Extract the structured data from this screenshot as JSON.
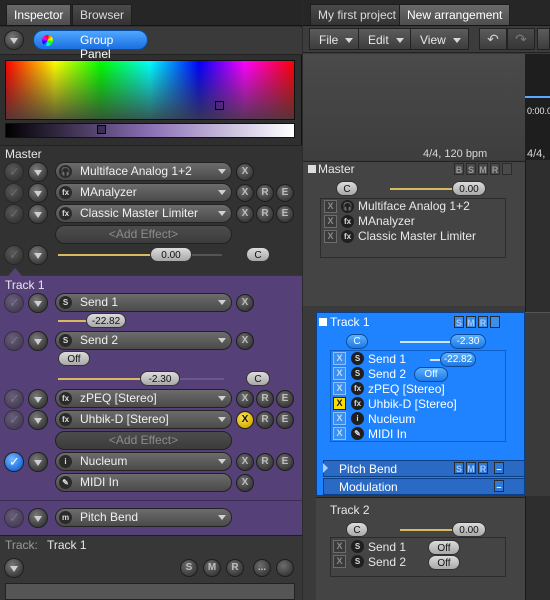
{
  "left_tabs": [
    "Inspector",
    "Browser"
  ],
  "right_tabs": [
    "My first project",
    "New arrangement"
  ],
  "inspector_header": {
    "group_panel": "Group Panel"
  },
  "master": {
    "label": "Master",
    "effects": [
      "Multiface Analog 1+2",
      "MAnalyzer",
      "Classic Master Limiter"
    ],
    "add_effect": "<Add Effect>",
    "volume": "0.00",
    "pan": "C"
  },
  "track1": {
    "label": "Track 1",
    "send1": "Send 1",
    "send1_value": "-22.82",
    "send2": "Send 2",
    "send2_value": "Off",
    "volume": "-2.30",
    "pan": "C",
    "effects": [
      "zPEQ [Stereo]",
      "Uhbik-D [Stereo]"
    ],
    "add_effect": "<Add Effect>",
    "instrument": "Nucleum",
    "midi_in": "MIDI In",
    "controller": "Pitch Bend"
  },
  "bottom": {
    "track_key": "Track:",
    "track_value": "Track 1",
    "ellipsis": "..."
  },
  "menu": {
    "file": "File",
    "edit": "Edit",
    "view": "View"
  },
  "ruler": {
    "time": "0:00.0",
    "signature": "4/4, 120 bpm",
    "signature2": "4/4,"
  },
  "arr_master": {
    "label": "Master",
    "pan": "C",
    "volume": "0.00",
    "effects": [
      "Multiface Analog 1+2",
      "MAnalyzer",
      "Classic Master Limiter"
    ]
  },
  "arr_track1": {
    "label": "Track 1",
    "pan": "C",
    "volume": "-2.30",
    "send1": "Send 1",
    "send1_value": "-22.82",
    "send2": "Send 2",
    "send2_value": "Off",
    "items": [
      "zPEQ [Stereo]",
      "Uhbik-D [Stereo]",
      "Nucleum",
      "MIDI In"
    ],
    "lanes": [
      "Pitch Bend",
      "Modulation"
    ]
  },
  "arr_track2": {
    "label": "Track 2",
    "pan": "C",
    "volume": "0.00",
    "send1": "Send 1",
    "send1_value": "Off",
    "send2": "Send 2",
    "send2_value": "Off"
  },
  "buttons": {
    "b": "B",
    "s": "S",
    "m": "M",
    "r": "R",
    "e": "E",
    "x": "X",
    "fx": "fx",
    "s_icon": "S",
    "i": "i",
    "m_icon": "m"
  },
  "colors": {
    "track_purple": "#554178",
    "selection_blue": "#1f83ff",
    "volume_line": "#d8b860"
  }
}
